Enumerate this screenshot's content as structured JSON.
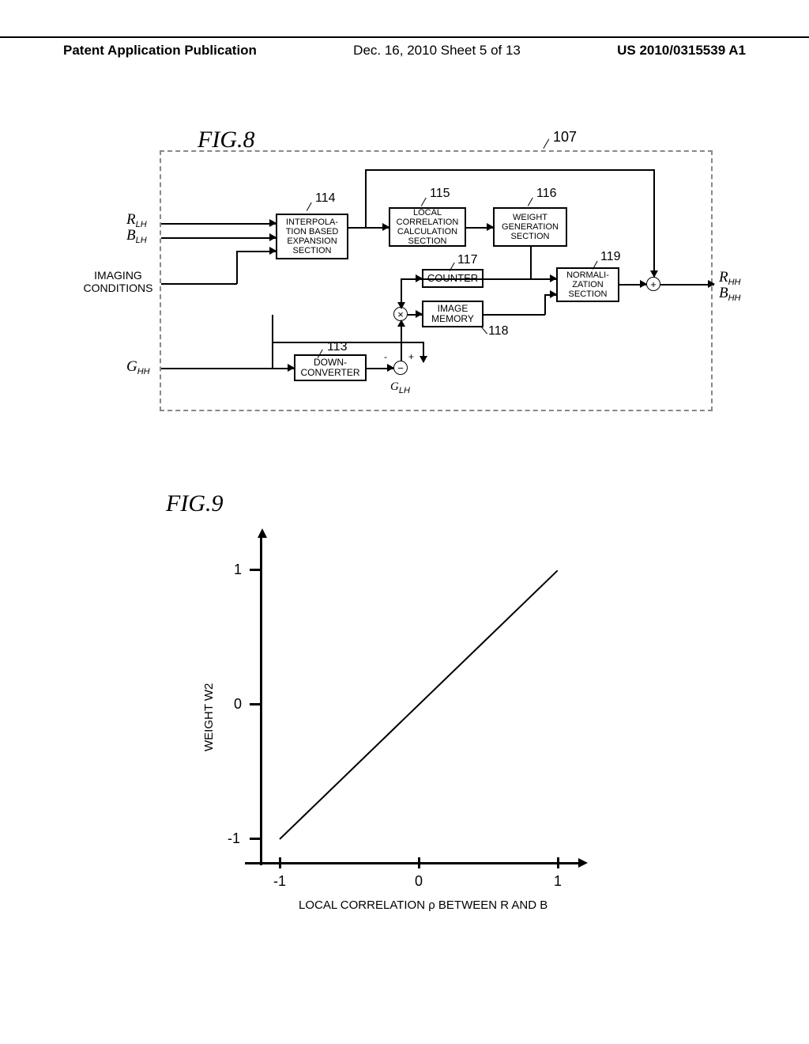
{
  "header": {
    "left": "Patent Application Publication",
    "center": "Dec. 16, 2010  Sheet 5 of 13",
    "right": "US 2010/0315539 A1"
  },
  "fig8": {
    "title": "FIG.8",
    "ref107": "107",
    "inputs": {
      "r": "R",
      "r_sub": "LH",
      "b": "B",
      "b_sub": "LH",
      "imaging": "IMAGING\nCONDITIONS",
      "g": "G",
      "g_sub": "HH"
    },
    "outputs": {
      "r": "R",
      "r_sub": "HH",
      "b": "B",
      "b_sub": "HH"
    },
    "blocks": {
      "b114": "INTERPOLA-\nTION BASED\nEXPANSION\nSECTION",
      "b115": "LOCAL\nCORRELATION\nCALCULATION\nSECTION",
      "b116": "WEIGHT\nGENERATION\nSECTION",
      "b117": "COUNTER",
      "b118": "IMAGE\nMEMORY",
      "b119": "NORMALI-\nZATION\nSECTION",
      "b113": "DOWN-\nCONVERTER"
    },
    "refs": {
      "r113": "113",
      "r114": "114",
      "r115": "115",
      "r116": "116",
      "r117": "117",
      "r118": "118",
      "r119": "119"
    },
    "sub_g_minus": "G",
    "sub_g_minus_sub": "LH",
    "minus": "-",
    "plus": "+"
  },
  "fig9": {
    "title": "FIG.9",
    "ylabel": "WEIGHT W2",
    "xlabel": "LOCAL CORRELATION ρ BETWEEN R AND B",
    "ticks": {
      "neg1": "-1",
      "zero": "0",
      "pos1": "1"
    }
  },
  "chart_data": {
    "type": "line",
    "title": "",
    "xlabel": "LOCAL CORRELATION ρ BETWEEN R AND B",
    "ylabel": "WEIGHT W2",
    "xlim": [
      -1,
      1
    ],
    "ylim": [
      -1,
      1
    ],
    "x": [
      -1,
      1
    ],
    "y": [
      -1,
      1
    ]
  }
}
